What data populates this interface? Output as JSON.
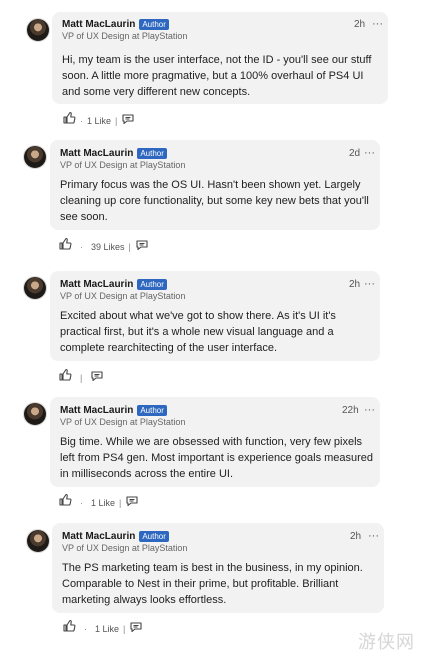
{
  "comments": [
    {
      "author": "Matt MacLaurin",
      "badge": "Author",
      "headline": "VP of UX Design at PlayStation",
      "time": "2h",
      "text": "Hi, my team is the user interface, not the ID - you'll see our stuff soon. A little more pragmative, but a 100% overhaul of PS4 UI and some very different new concepts.",
      "likes": "1 Like"
    },
    {
      "author": "Matt MacLaurin",
      "badge": "Author",
      "headline": "VP of UX Design at PlayStation",
      "time": "2d",
      "text": "Primary focus was the OS UI. Hasn't been shown yet. Largely cleaning up core functionality, but some key new bets that you'll see soon.",
      "likes": "39 Likes"
    },
    {
      "author": "Matt MacLaurin",
      "badge": "Author",
      "headline": "VP of UX Design at PlayStation",
      "time": "2h",
      "text": "Excited about what we've got to show there. As it's UI it's practical first, but it's a whole new visual language and a complete rearchitecting of the user interface.",
      "likes": ""
    },
    {
      "author": "Matt MacLaurin",
      "badge": "Author",
      "headline": "VP of UX Design at PlayStation",
      "time": "22h",
      "text": "Big time. While we are obsessed with function, very few pixels left from PS4 gen. Most important is experience goals measured in milliseconds across the entire UI.",
      "likes": "1 Like"
    },
    {
      "author": "Matt MacLaurin",
      "badge": "Author",
      "headline": "VP of UX Design at PlayStation",
      "time": "2h",
      "text": "The PS marketing team is best in the business, in my opinion. Comparable to Nest in their prime, but profitable. Brilliant marketing always looks effortless.",
      "likes": "1 Like"
    }
  ],
  "icons": {
    "like": "thumbs-up-icon",
    "reply": "reply-icon",
    "more": "more-dots-icon"
  },
  "more_glyph": "···",
  "separator": "·",
  "colors": {
    "badge": "#2d67c0",
    "bubble": "#f2f2f2"
  },
  "watermark": "游侠网"
}
